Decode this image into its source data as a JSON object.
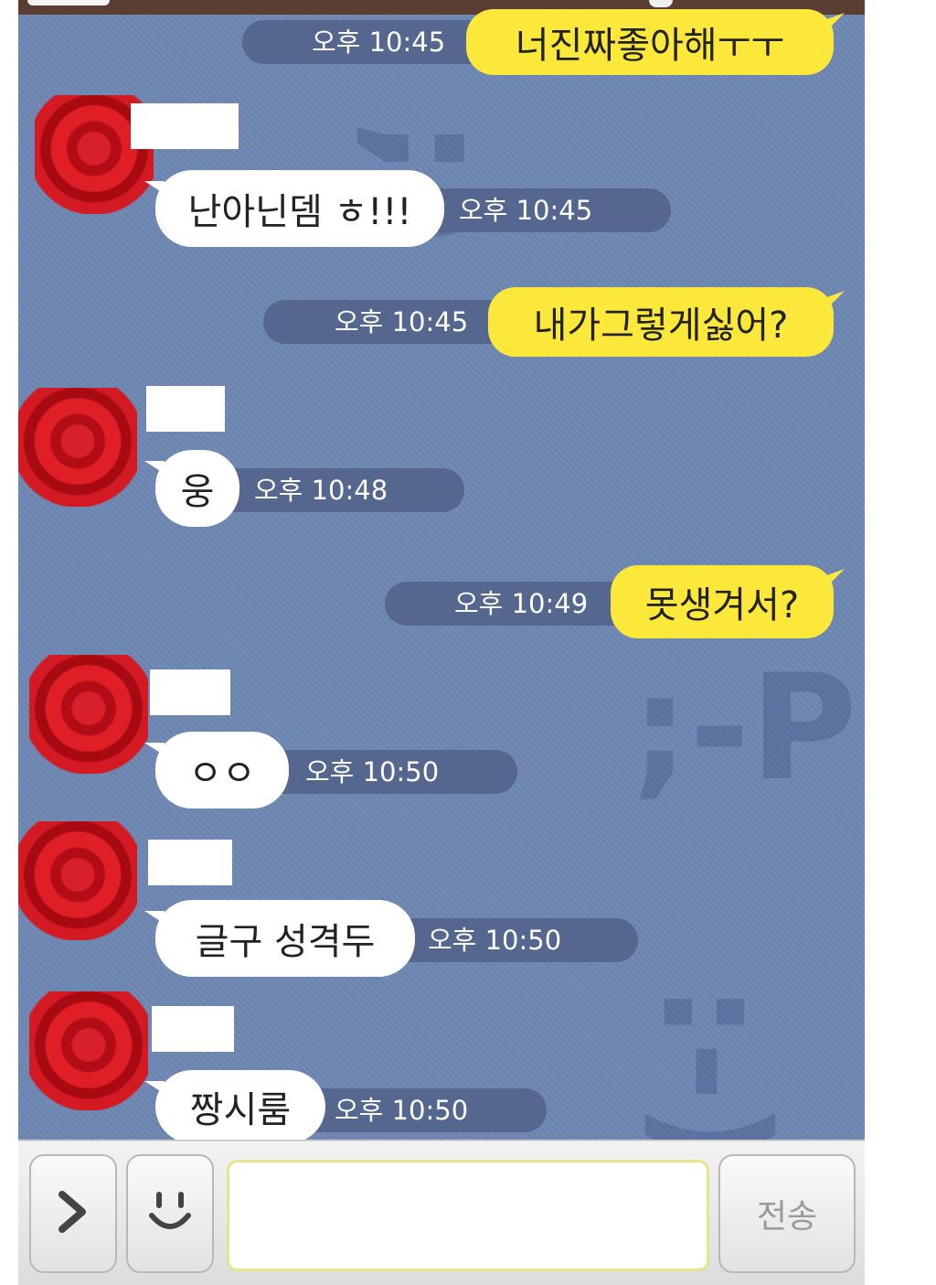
{
  "messages": [
    {
      "side": "me",
      "text": "너진짜좋아해ㅜㅜ",
      "time": "오후 10:45"
    },
    {
      "side": "them",
      "text": "난아닌뎀 ㅎ!!!",
      "time": "오후 10:45"
    },
    {
      "side": "me",
      "text": "내가그렇게싫어?",
      "time": "오후 10:45"
    },
    {
      "side": "them",
      "text": "웅",
      "time": "오후 10:48"
    },
    {
      "side": "me",
      "text": "못생겨서?",
      "time": "오후 10:49"
    },
    {
      "side": "them",
      "text": "ㅇㅇ",
      "time": "오후 10:50"
    },
    {
      "side": "them",
      "text": "글구 성격두",
      "time": "오후 10:50"
    },
    {
      "side": "them",
      "text": "짱시룸",
      "time": "오후 10:50"
    }
  ],
  "background_emoticons": [
    ";)",
    ";-P",
    ":-)"
  ],
  "composer": {
    "expand_icon": "chevron-right-icon",
    "emoticon_icon": "smiley-icon",
    "input_value": "",
    "send_label": "전송"
  },
  "colors": {
    "chat_background": "#6b84b0",
    "my_bubble": "#fbe83a",
    "their_bubble": "#ffffff",
    "time_pill": "#55678f"
  }
}
